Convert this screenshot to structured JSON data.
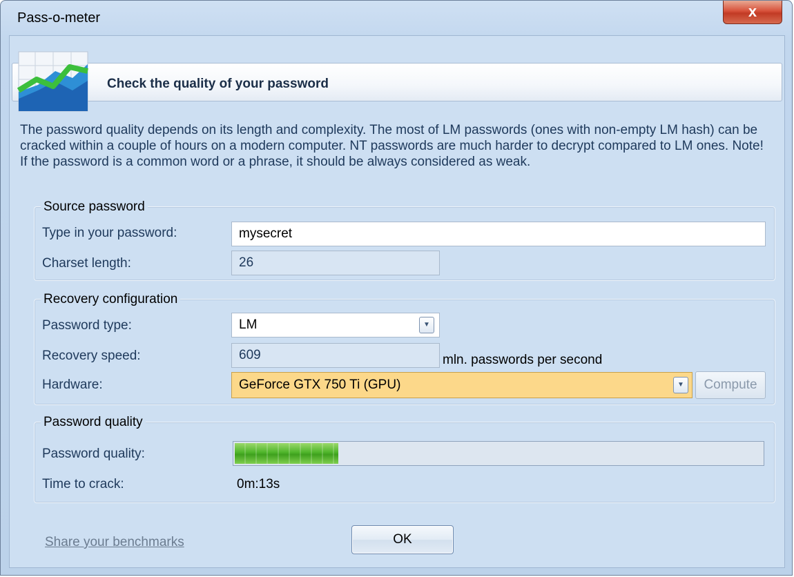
{
  "window": {
    "title": "Pass-o-meter",
    "close_label": "x"
  },
  "header": {
    "title": "Check the quality of your password",
    "icon": "chart-icon"
  },
  "description": "The password quality depends on its length and complexity. The most of LM passwords (ones with non-empty LM hash) can be cracked within a couple of hours on a modern computer. NT passwords are much harder to decrypt compared to LM ones. Note! If the password is a common word or a phrase, it should be always considered as weak.",
  "source": {
    "title": "Source password",
    "password_label": "Type in your password:",
    "password_value": "mysecret",
    "charset_label": "Charset length:",
    "charset_value": "26"
  },
  "recovery": {
    "title": "Recovery configuration",
    "type_label": "Password type:",
    "type_value": "LM",
    "speed_label": "Recovery speed:",
    "speed_value": "609",
    "speed_unit": "mln. passwords per second",
    "hardware_label": "Hardware:",
    "hardware_value": "GeForce GTX 750 Ti (GPU)",
    "compute_label": "Compute"
  },
  "quality": {
    "title": "Password quality",
    "quality_label": "Password quality:",
    "quality_fraction": 0.2,
    "time_label": "Time to crack:",
    "time_value": "0m:13s"
  },
  "footer": {
    "benchmarks_link": "Share your benchmarks",
    "ok_label": "OK"
  },
  "colors": {
    "accent_hardware": "#fcd88a",
    "progress_green": "#4fb52b",
    "close_red": "#c23a24"
  }
}
